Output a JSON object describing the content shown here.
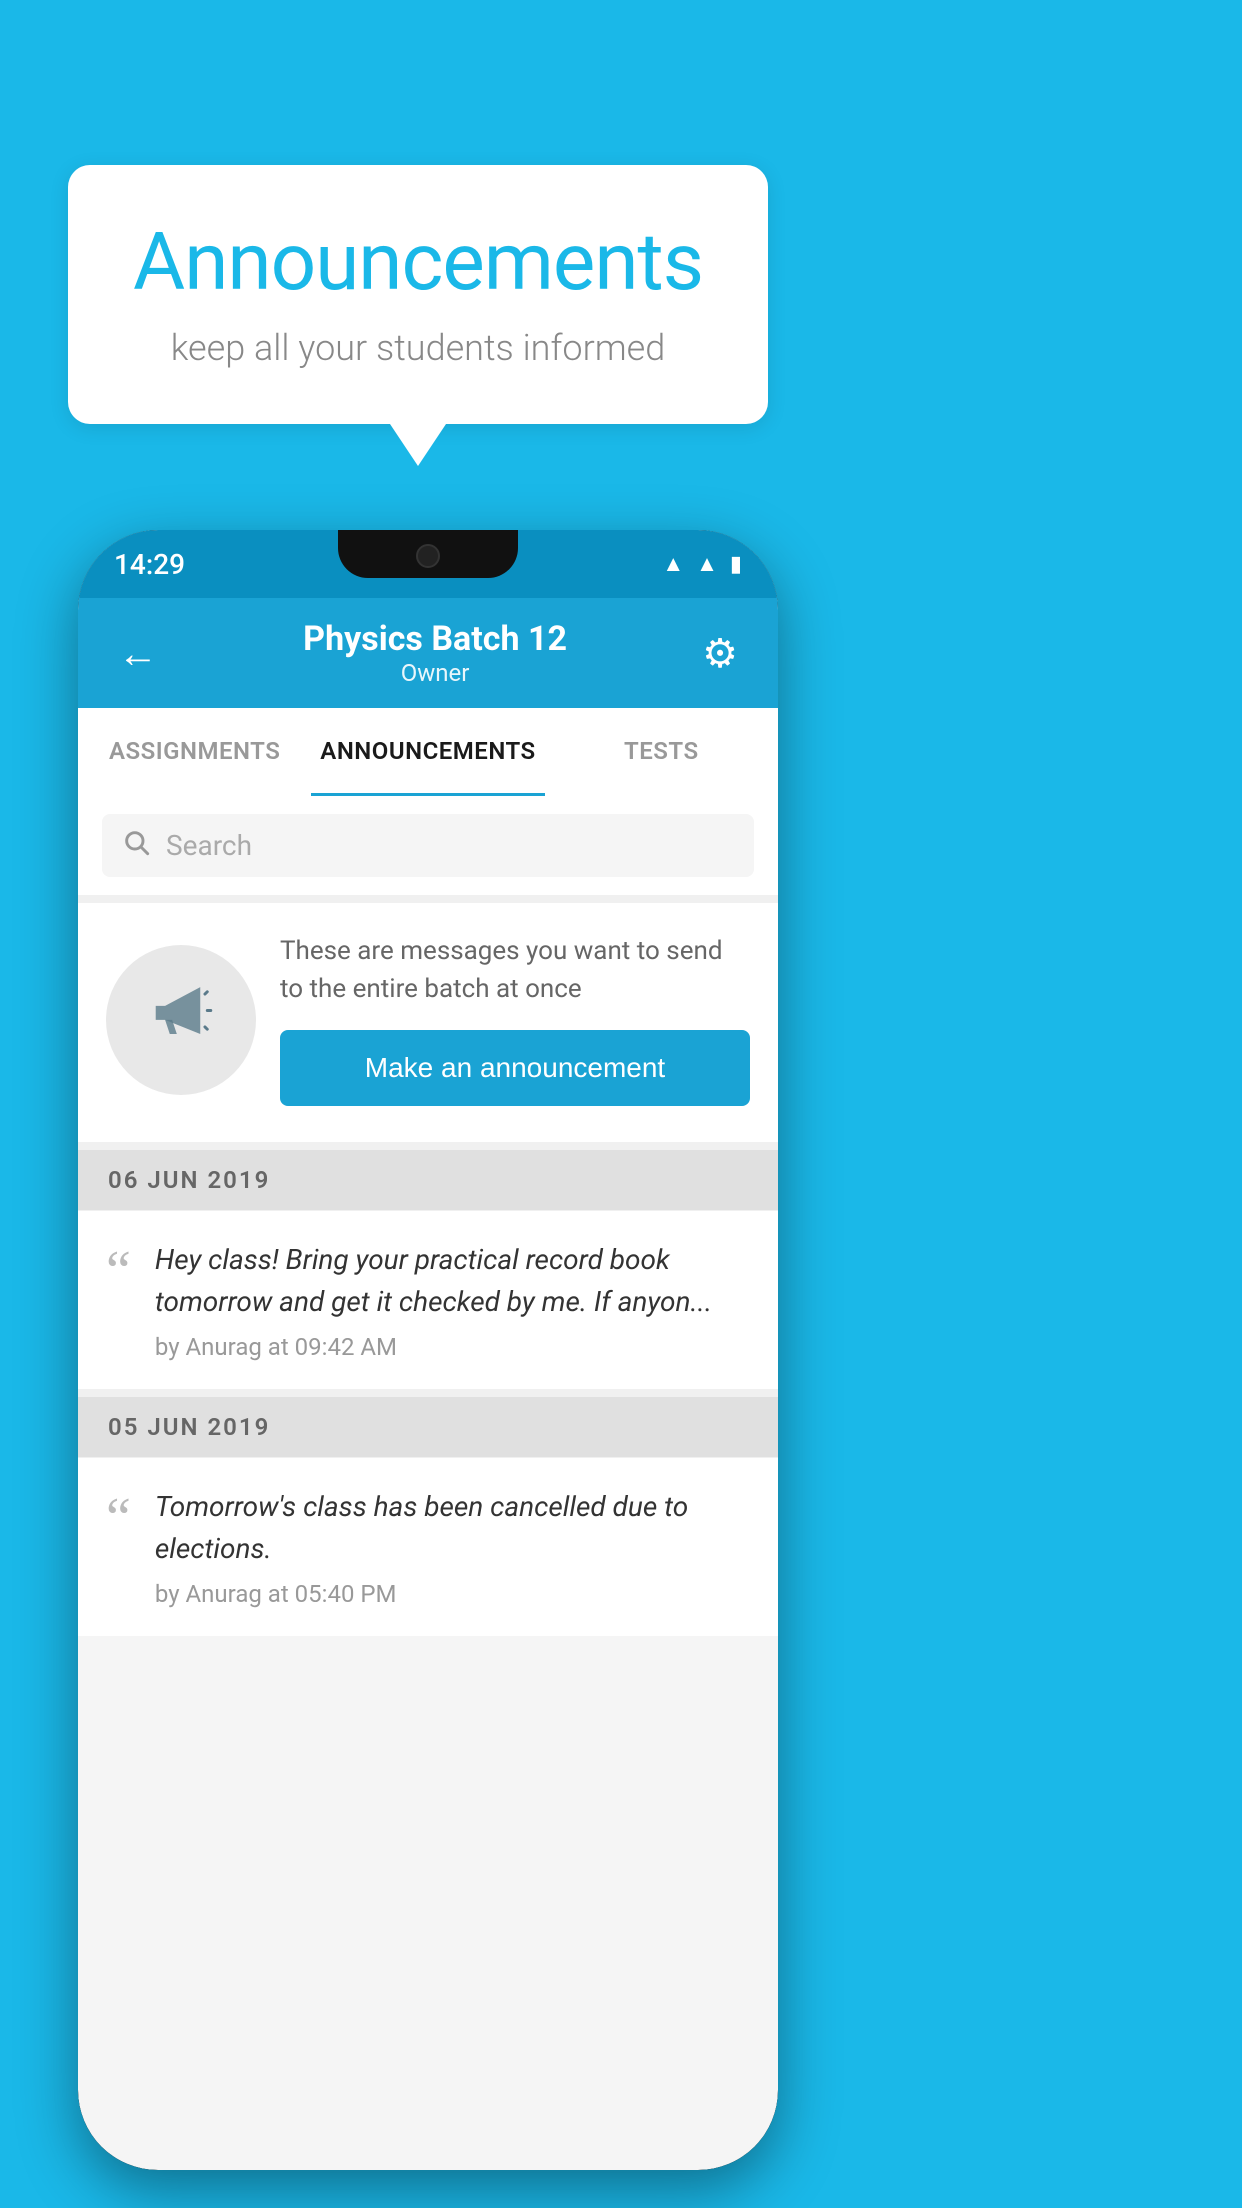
{
  "background_color": "#1ab8e8",
  "speech_bubble": {
    "title": "Announcements",
    "subtitle": "keep all your students informed"
  },
  "phone": {
    "status_bar": {
      "time": "14:29",
      "icons": [
        "wifi",
        "signal",
        "battery"
      ]
    },
    "app_bar": {
      "title": "Physics Batch 12",
      "subtitle": "Owner",
      "back_label": "←",
      "settings_label": "⚙"
    },
    "tabs": [
      {
        "label": "ASSIGNMENTS",
        "active": false
      },
      {
        "label": "ANNOUNCEMENTS",
        "active": true
      },
      {
        "label": "TESTS",
        "active": false
      }
    ],
    "search": {
      "placeholder": "Search"
    },
    "promo": {
      "description": "These are messages you want to send to the entire batch at once",
      "button_label": "Make an announcement"
    },
    "announcements": [
      {
        "date": "06  JUN  2019",
        "text": "Hey class! Bring your practical record book tomorrow and get it checked by me. If anyon...",
        "meta": "by Anurag at 09:42 AM"
      },
      {
        "date": "05  JUN  2019",
        "text": "Tomorrow's class has been cancelled due to elections.",
        "meta": "by Anurag at 05:40 PM"
      }
    ]
  }
}
